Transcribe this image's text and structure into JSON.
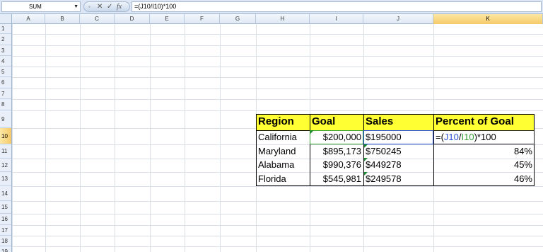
{
  "name_box": "SUM",
  "formula_bar": {
    "cancel_icon": "✕",
    "enter_icon": "✓",
    "function_icon": "fx",
    "formula": "=(J10/I10)*100"
  },
  "columns": [
    "A",
    "B",
    "C",
    "D",
    "E",
    "F",
    "G",
    "H",
    "I",
    "J",
    "K"
  ],
  "rows": [
    "1",
    "2",
    "3",
    "4",
    "5",
    "6",
    "7",
    "8",
    "9",
    "10",
    "11",
    "12",
    "13",
    "14",
    "15",
    "16",
    "17",
    "18",
    "19"
  ],
  "active_column": "K",
  "active_row": "10",
  "table": {
    "headers": [
      "Region",
      "Goal",
      "Sales",
      "Percent of Goal"
    ],
    "rows": [
      {
        "region": "California",
        "goal": "$200,000",
        "sales": "$195000",
        "percent_parts": [
          "=(",
          "J10",
          "/",
          "I10",
          ")*100"
        ]
      },
      {
        "region": "Maryland",
        "goal": "$895,173",
        "sales": "$750245",
        "percent": "84%"
      },
      {
        "region": "Alabama",
        "goal": "$990,376",
        "sales": "$449278",
        "percent": "45%"
      },
      {
        "region": "Florida",
        "goal": "$545,981",
        "sales": "$249578",
        "percent": "46%"
      }
    ]
  },
  "colors": {
    "header_fill": "#ffff33",
    "ref_blue": "#2a4fd6",
    "ref_green": "#34a034",
    "active_header": "#f6c96a"
  }
}
